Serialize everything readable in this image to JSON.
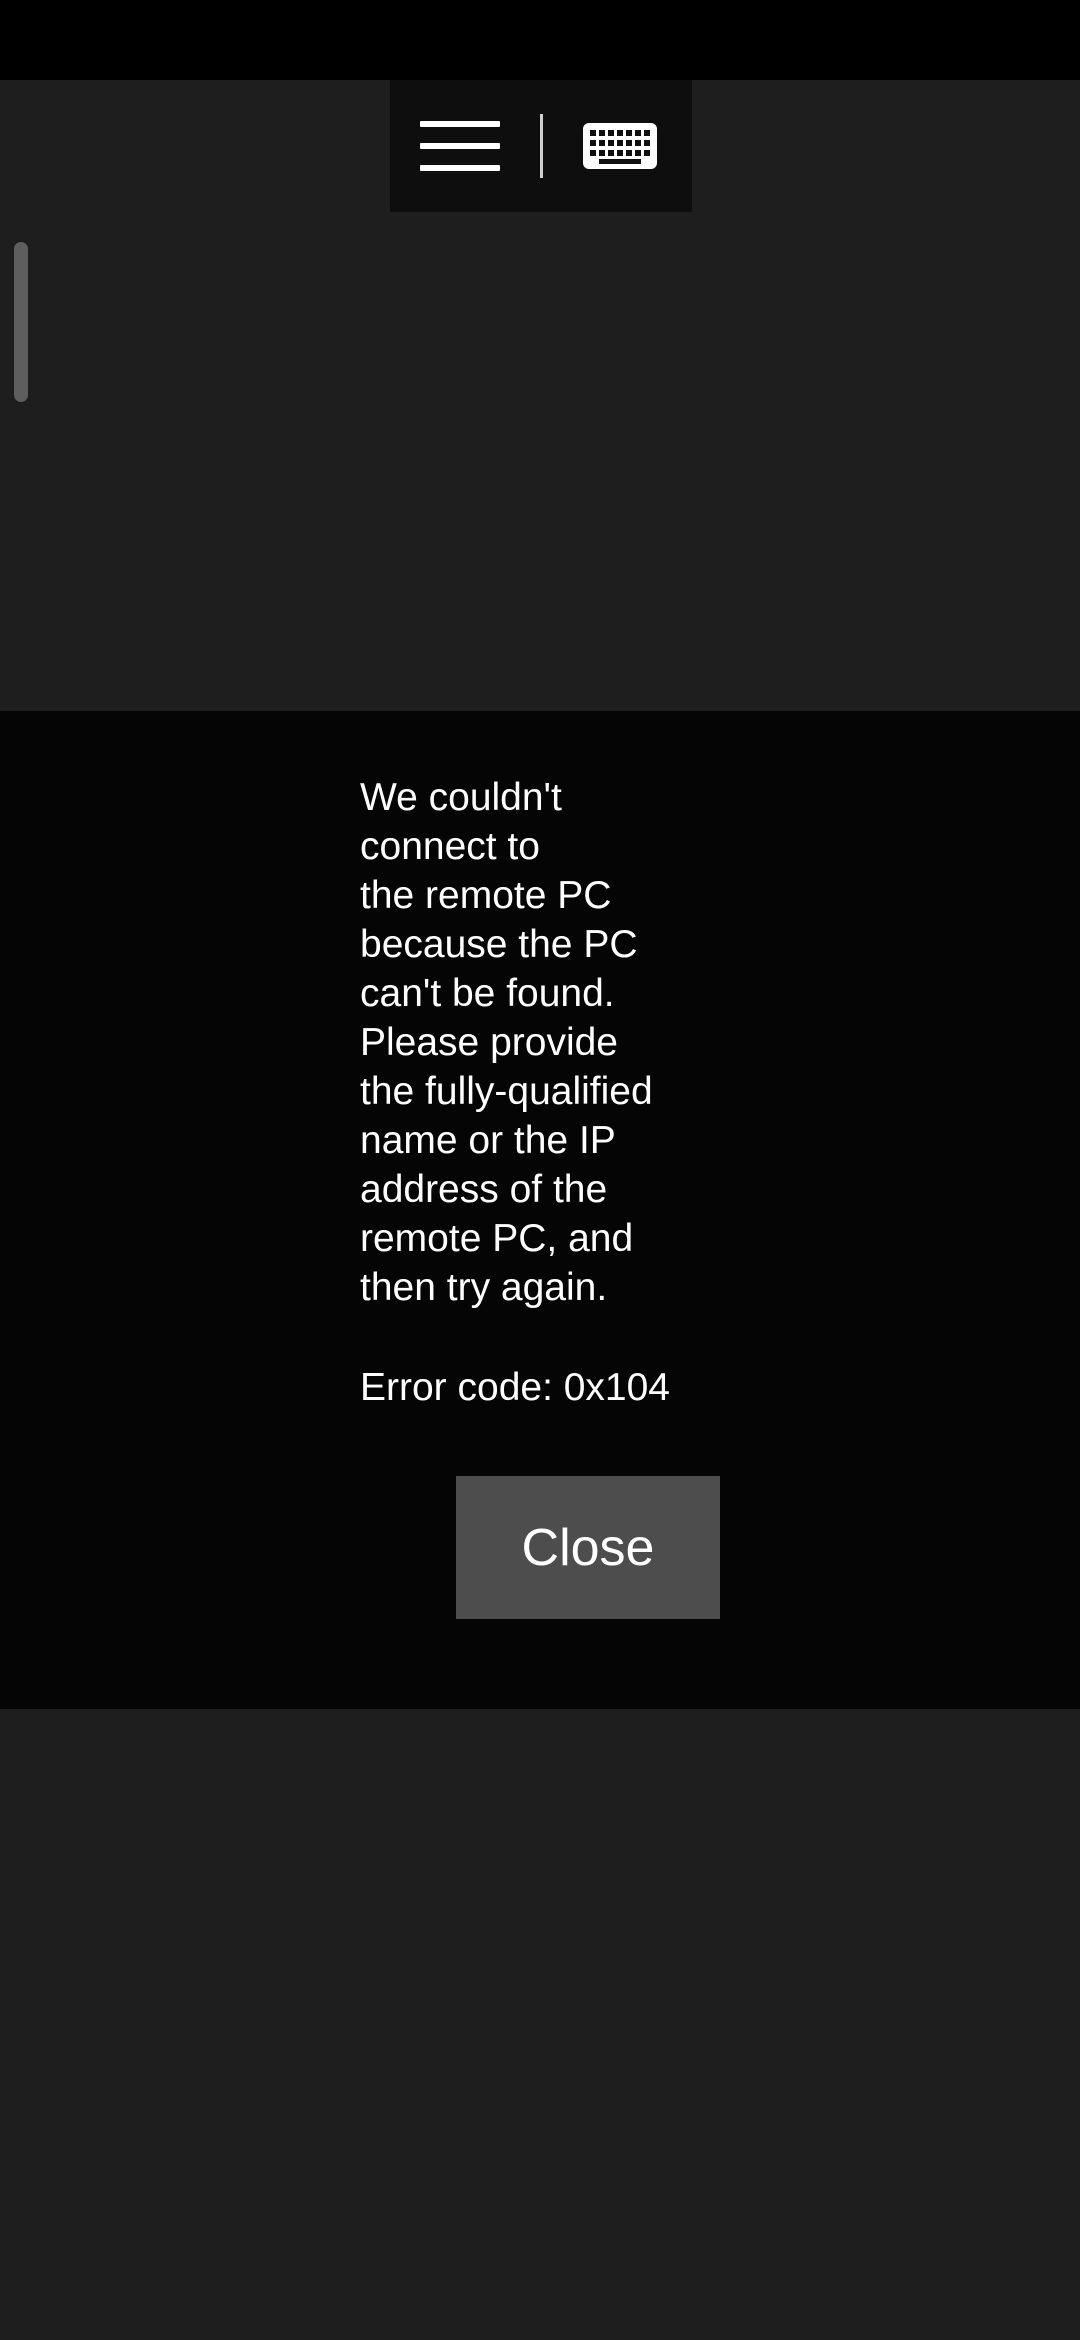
{
  "toolbar": {
    "menu_icon": "hamburger-menu-icon",
    "keyboard_icon": "keyboard-icon"
  },
  "dialog": {
    "message": "We couldn't\nconnect to\nthe remote PC\nbecause the PC\ncan't be found.\nPlease provide\nthe fully-qualified\nname or the IP\naddress of the\nremote PC, and\nthen try again.",
    "error_code": "Error code: 0x104",
    "close_label": "Close"
  },
  "colors": {
    "background": "#1e1e1e",
    "status_bar": "#000000",
    "toolbar": "#0e0e0e",
    "dialog_band": "#050505",
    "button": "#4d4d4d",
    "text": "#ffffff"
  }
}
